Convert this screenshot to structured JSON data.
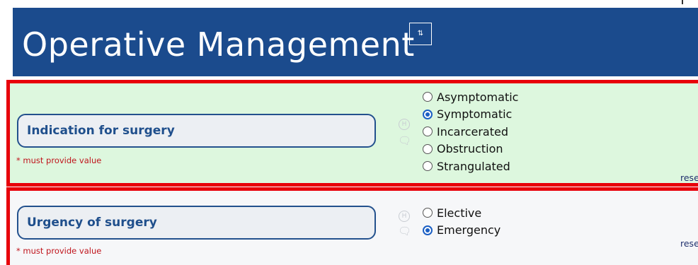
{
  "header": {
    "title": "Operative Management",
    "icon_glyph": "⇅",
    "background": "#1b4b8d"
  },
  "sections": [
    {
      "label": "Indication for surgery",
      "required_text": "* must provide value",
      "options": [
        "Asymptomatic",
        "Symptomatic",
        "Incarcerated",
        "Obstruction",
        "Strangulated"
      ],
      "selected": "Symptomatic",
      "reset_label": "reset",
      "background": "#ddf7de"
    },
    {
      "label": "Urgency of surgery",
      "required_text": "* must provide value",
      "options": [
        "Elective",
        "Emergency"
      ],
      "selected": "Emergency",
      "reset_label": "reset",
      "background": "#f6f7f9"
    }
  ],
  "icons": {
    "history": "H",
    "comment": "💬"
  },
  "colors": {
    "highlight_border": "#e8000b",
    "label_text": "#1f4f8c",
    "required_text": "#c0151d",
    "radio_selected": "#1b5fc4"
  }
}
